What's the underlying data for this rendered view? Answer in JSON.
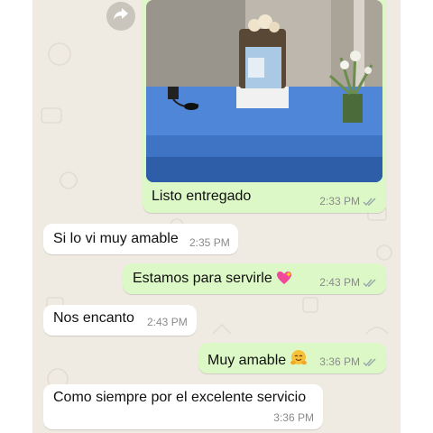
{
  "colors": {
    "outgoing": "#dcf8c6",
    "incoming": "#ffffff",
    "background": "#efeae2",
    "read_ticks": "#9aa4a8"
  },
  "photo_message": {
    "caption": "Listo entregado",
    "time": "2:33 PM",
    "status": "read",
    "image": "blue-table-cake-photo",
    "forward_icon": "forward-icon"
  },
  "messages": [
    {
      "side": "in",
      "text": "Si lo vi muy amable",
      "time": "2:35 PM"
    },
    {
      "side": "out",
      "text": "Estamos para servirle",
      "emoji": "sparkling-heart",
      "time": "2:43 PM",
      "status": "read"
    },
    {
      "side": "in",
      "text": "Nos encanto",
      "time": "2:43 PM"
    },
    {
      "side": "out",
      "text": "Muy amable",
      "emoji": "smiling-face-with-open-hands",
      "time": "3:36 PM",
      "status": "read"
    },
    {
      "side": "in",
      "text": "Como siempre por el excelente servicio",
      "time": "3:36 PM"
    }
  ]
}
